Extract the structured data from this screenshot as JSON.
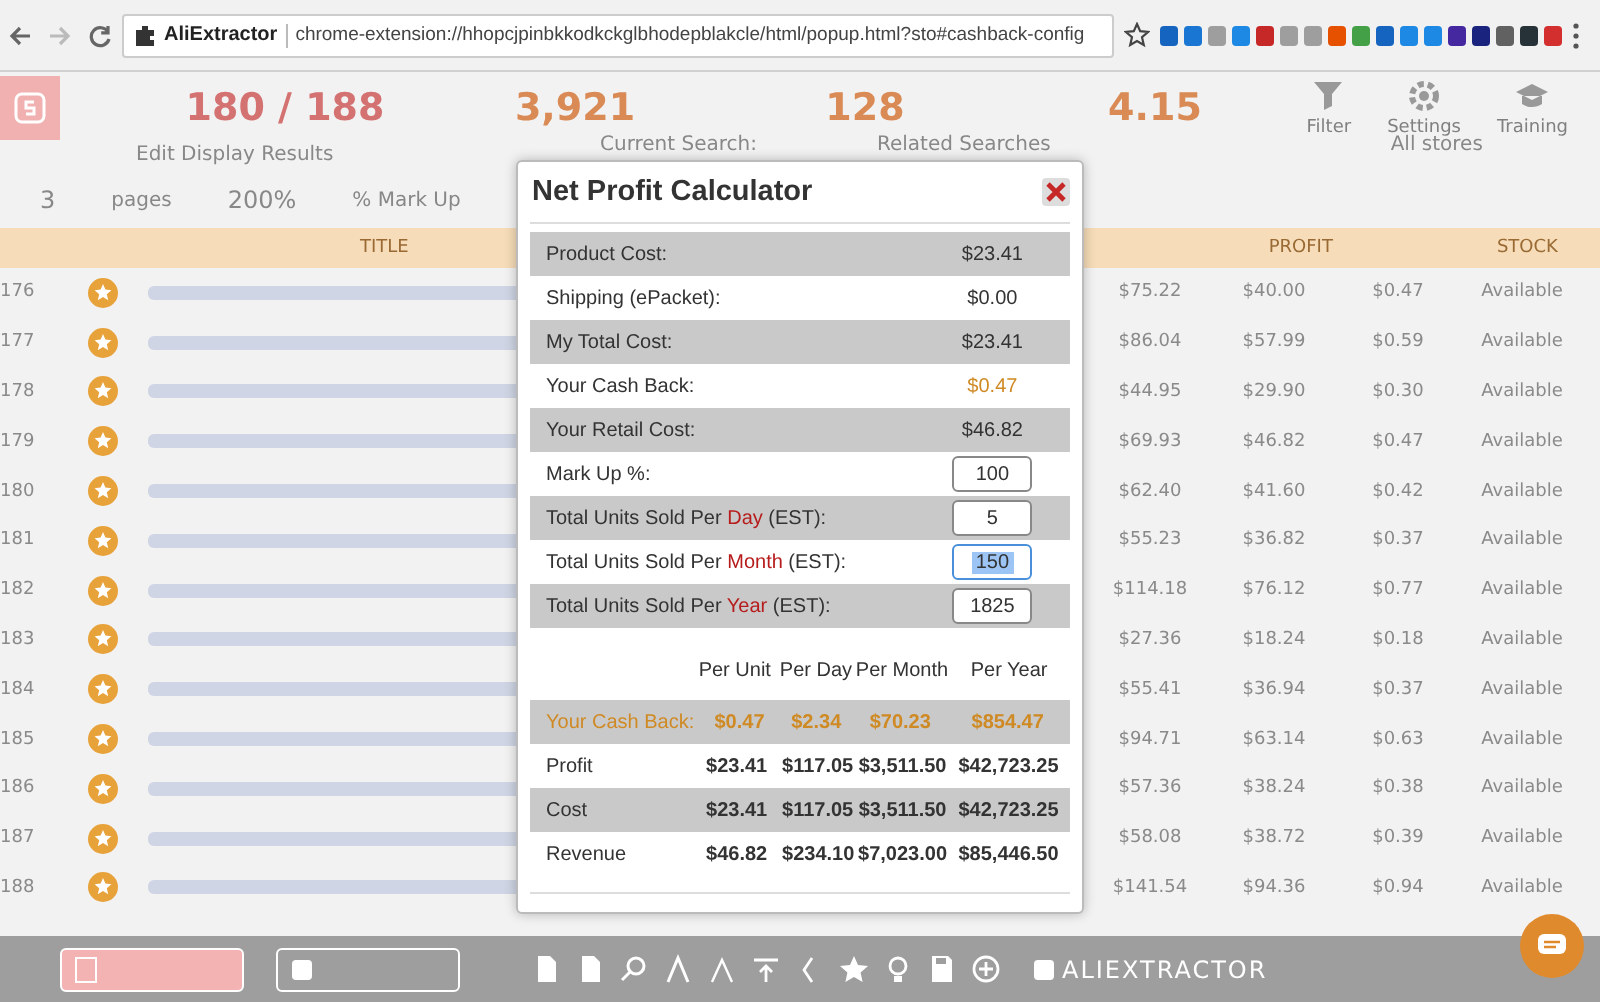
{
  "browser": {
    "site_name": "AliExtractor",
    "url": "chrome-extension://hhopcjpinbkkodkckglbhodepblakcle/html/popup.html?sto#cashback-config"
  },
  "app": {
    "stats": [
      {
        "value": "180 / 188",
        "color": "#d47272"
      },
      {
        "value": "3,921",
        "color": "#d98a55"
      },
      {
        "value": "128",
        "color": "#d98a55"
      },
      {
        "value": "4.15",
        "color": "#d98a55"
      }
    ],
    "toolbar": [
      {
        "label": "Filter",
        "kind": "filter"
      },
      {
        "label": "Settings",
        "kind": "gear"
      },
      {
        "label": "Training",
        "kind": "cap"
      }
    ],
    "display": {
      "title": "Edit Display Results",
      "pages": "3",
      "pages_label": "pages",
      "markup": "200%",
      "markup_label": "% Mark Up"
    },
    "search_tabs": [
      "Current Search:",
      "Related Searches"
    ],
    "store_filter": "All stores",
    "table": {
      "columns": [
        "TITLE",
        "PROFIT",
        "STOCK"
      ],
      "rows": [
        {
          "index": "176",
          "retail": "$75.22",
          "profit": "$40.00",
          "cashback": "$0.47",
          "stock": "Available"
        },
        {
          "index": "177",
          "retail": "$86.04",
          "profit": "$57.99",
          "cashback": "$0.59",
          "stock": "Available"
        },
        {
          "index": "178",
          "retail": "$44.95",
          "profit": "$29.90",
          "cashback": "$0.30",
          "stock": "Available"
        },
        {
          "index": "179",
          "retail": "$69.93",
          "profit": "$46.82",
          "cashback": "$0.47",
          "stock": "Available"
        },
        {
          "index": "180",
          "retail": "$62.40",
          "profit": "$41.60",
          "cashback": "$0.42",
          "stock": "Available"
        },
        {
          "index": "181",
          "retail": "$55.23",
          "profit": "$36.82",
          "cashback": "$0.37",
          "stock": "Available"
        },
        {
          "index": "182",
          "retail": "$114.18",
          "profit": "$76.12",
          "cashback": "$0.77",
          "stock": "Available"
        },
        {
          "index": "183",
          "retail": "$27.36",
          "profit": "$18.24",
          "cashback": "$0.18",
          "stock": "Available"
        },
        {
          "index": "184",
          "retail": "$55.41",
          "profit": "$36.94",
          "cashback": "$0.37",
          "stock": "Available"
        },
        {
          "index": "185",
          "retail": "$94.71",
          "profit": "$63.14",
          "cashback": "$0.63",
          "stock": "Available"
        },
        {
          "index": "186",
          "retail": "$57.36",
          "profit": "$38.24",
          "cashback": "$0.38",
          "stock": "Available"
        },
        {
          "index": "187",
          "retail": "$58.08",
          "profit": "$38.72",
          "cashback": "$0.39",
          "stock": "Available"
        },
        {
          "index": "188",
          "retail": "$141.54",
          "profit": "$94.36",
          "cashback": "$0.94",
          "stock": "Available"
        }
      ]
    }
  },
  "modal": {
    "title": "Net Profit Calculator",
    "rows": [
      {
        "kind": "text",
        "label": "Product Cost:",
        "value": "$23.41"
      },
      {
        "kind": "text",
        "label": "Shipping (ePacket):",
        "value": "$0.00"
      },
      {
        "kind": "text",
        "label": "My Total Cost:",
        "value": "$23.41"
      },
      {
        "kind": "cashback",
        "label": "Your Cash Back:",
        "value": "$0.47"
      },
      {
        "kind": "text",
        "label": "Your Retail Cost:",
        "value": "$46.82"
      },
      {
        "kind": "input",
        "label": "Mark Up %:",
        "value": "100",
        "selected": false
      },
      {
        "kind": "input",
        "label": "Total Units Sold Per ",
        "highlight": "Day",
        "label_end": " (EST):",
        "value": "5",
        "selected": false
      },
      {
        "kind": "input",
        "label": "Total Units Sold Per ",
        "highlight": "Month",
        "label_end": " (EST):",
        "value": "150",
        "selected": true
      },
      {
        "kind": "input",
        "label": "Total Units Sold Per ",
        "highlight": "Year",
        "label_end": " (EST):",
        "value": "1825",
        "selected": false
      }
    ],
    "summary": {
      "columns": [
        "Per Unit",
        "Per Day",
        "Per Month",
        "Per Year"
      ],
      "rows": [
        {
          "kind": "cashback",
          "label": "Your Cash Back:",
          "values": [
            "$0.47",
            "$2.34",
            "$70.23",
            "$854.47"
          ]
        },
        {
          "kind": "plain",
          "label": "Profit",
          "values": [
            "$23.41",
            "$117.05",
            "$3,511.50",
            "$42,723.25"
          ]
        },
        {
          "kind": "plain",
          "label": "Cost",
          "values": [
            "$23.41",
            "$117.05",
            "$3,511.50",
            "$42,723.25"
          ]
        },
        {
          "kind": "plain",
          "label": "Revenue",
          "values": [
            "$46.82",
            "$234.10",
            "$7,023.00",
            "$85,446.50"
          ]
        }
      ]
    }
  },
  "bottom_bar": {
    "brand": "ALIEXTRACTOR"
  }
}
